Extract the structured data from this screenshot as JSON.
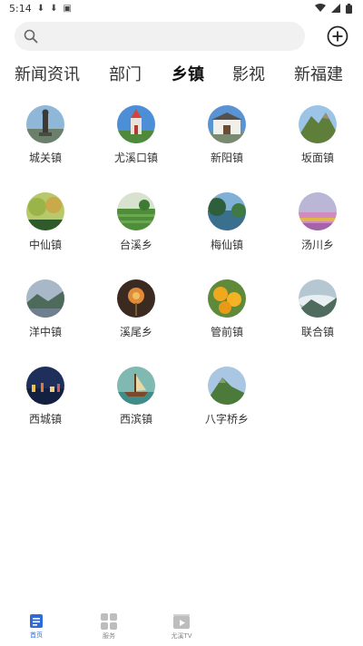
{
  "status": {
    "time": "5:14"
  },
  "search": {
    "placeholder": ""
  },
  "tabs": [
    {
      "label": "新闻资讯",
      "active": false
    },
    {
      "label": "部门",
      "active": false
    },
    {
      "label": "乡镇",
      "active": true
    },
    {
      "label": "影视",
      "active": false
    },
    {
      "label": "新福建",
      "active": false
    }
  ],
  "towns": [
    {
      "name": "城关镇",
      "icon": "statue-photo"
    },
    {
      "name": "尤溪口镇",
      "icon": "church-photo"
    },
    {
      "name": "新阳镇",
      "icon": "gate-photo"
    },
    {
      "name": "坂面镇",
      "icon": "mountain-photo"
    },
    {
      "name": "中仙镇",
      "icon": "forest-photo"
    },
    {
      "name": "台溪乡",
      "icon": "tea-field-photo"
    },
    {
      "name": "梅仙镇",
      "icon": "river-photo"
    },
    {
      "name": "汤川乡",
      "icon": "flowers-photo"
    },
    {
      "name": "洋中镇",
      "icon": "hills-photo"
    },
    {
      "name": "溪尾乡",
      "icon": "flower-photo"
    },
    {
      "name": "管前镇",
      "icon": "oranges-photo"
    },
    {
      "name": "联合镇",
      "icon": "clouds-photo"
    },
    {
      "name": "西城镇",
      "icon": "night-city-photo"
    },
    {
      "name": "西滨镇",
      "icon": "boat-photo"
    },
    {
      "name": "八字桥乡",
      "icon": "peak-photo"
    }
  ],
  "bottom_nav": [
    {
      "label": "首页",
      "icon": "home-icon",
      "active": true
    },
    {
      "label": "服务",
      "icon": "grid-icon",
      "active": false
    },
    {
      "label": "尤溪TV",
      "icon": "video-icon",
      "active": false
    },
    {
      "label": "",
      "icon": "blank",
      "active": false
    },
    {
      "label": "",
      "icon": "blank",
      "active": false
    }
  ],
  "colors": {
    "accent": "#2f6bd8",
    "search_bg": "#f1f1f1",
    "text": "#333333"
  }
}
